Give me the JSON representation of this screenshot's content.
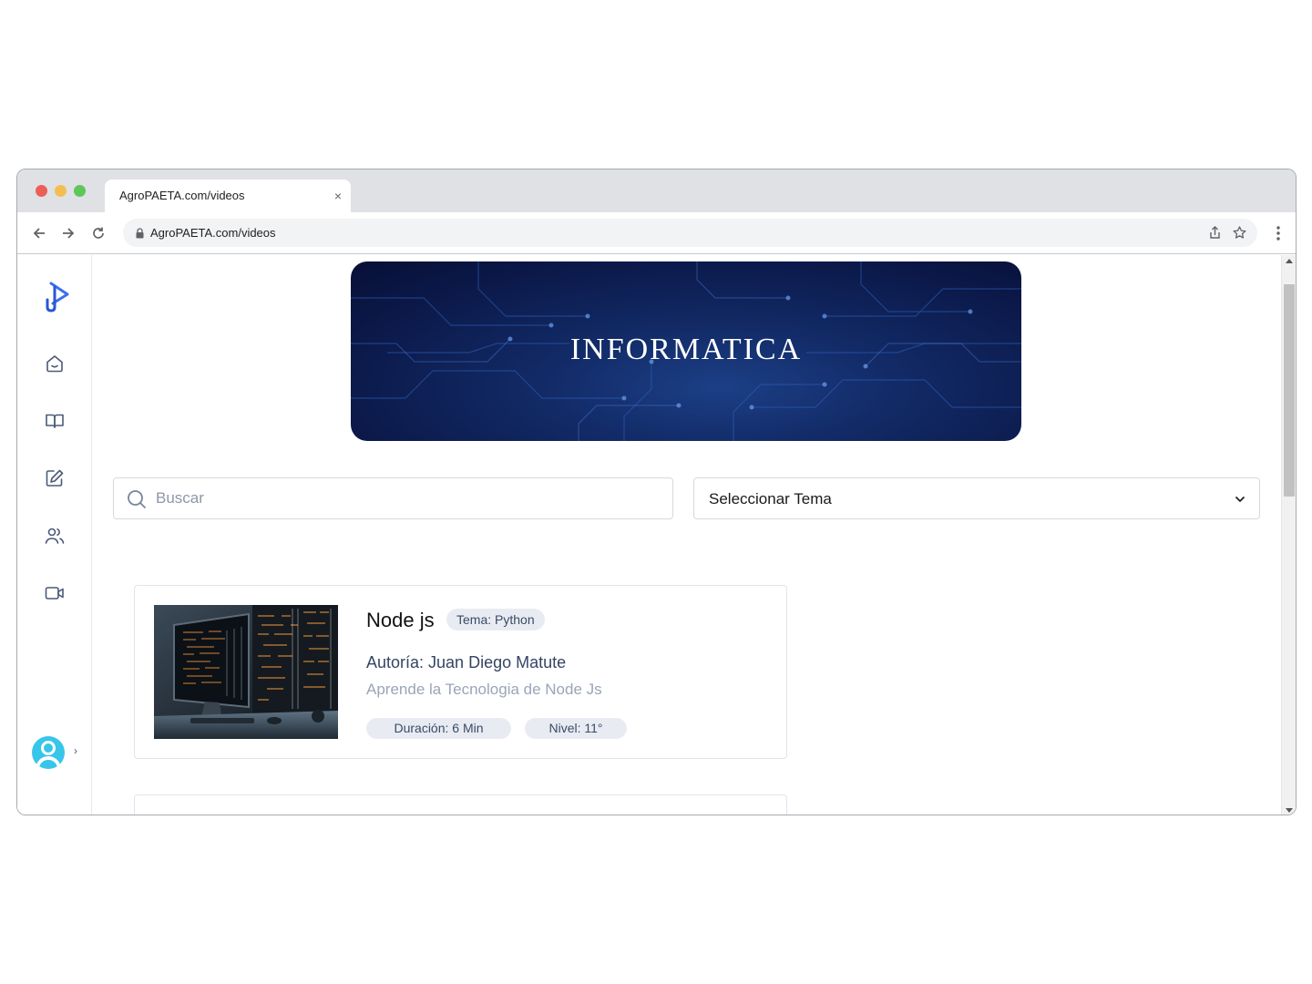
{
  "browser": {
    "tab_title": "AgroPAETA.com/videos",
    "tab_close": "×",
    "url": "AgroPAETA.com/videos"
  },
  "sidebar": {
    "items": [
      {
        "icon": "home-icon"
      },
      {
        "icon": "book-icon"
      },
      {
        "icon": "edit-icon"
      },
      {
        "icon": "users-icon"
      },
      {
        "icon": "video-icon"
      }
    ],
    "avatar_caret": "›"
  },
  "banner": {
    "title": "INFORMATICA"
  },
  "search": {
    "placeholder": "Buscar"
  },
  "topic_select": {
    "label": "Seleccionar Tema"
  },
  "videos": [
    {
      "title": "Node js",
      "tag": "Tema: Python",
      "author": "Autoría: Juan Diego Matute",
      "description": "Aprende la Tecnologia de Node Js",
      "duration": "Duración: 6 Min",
      "level": "Nivel: 11°"
    }
  ],
  "colors": {
    "brand": "#3b6ff0",
    "banner_bg": "#0b1848",
    "avatar": "#38c5ea",
    "pill_bg": "#e8ecf2"
  }
}
